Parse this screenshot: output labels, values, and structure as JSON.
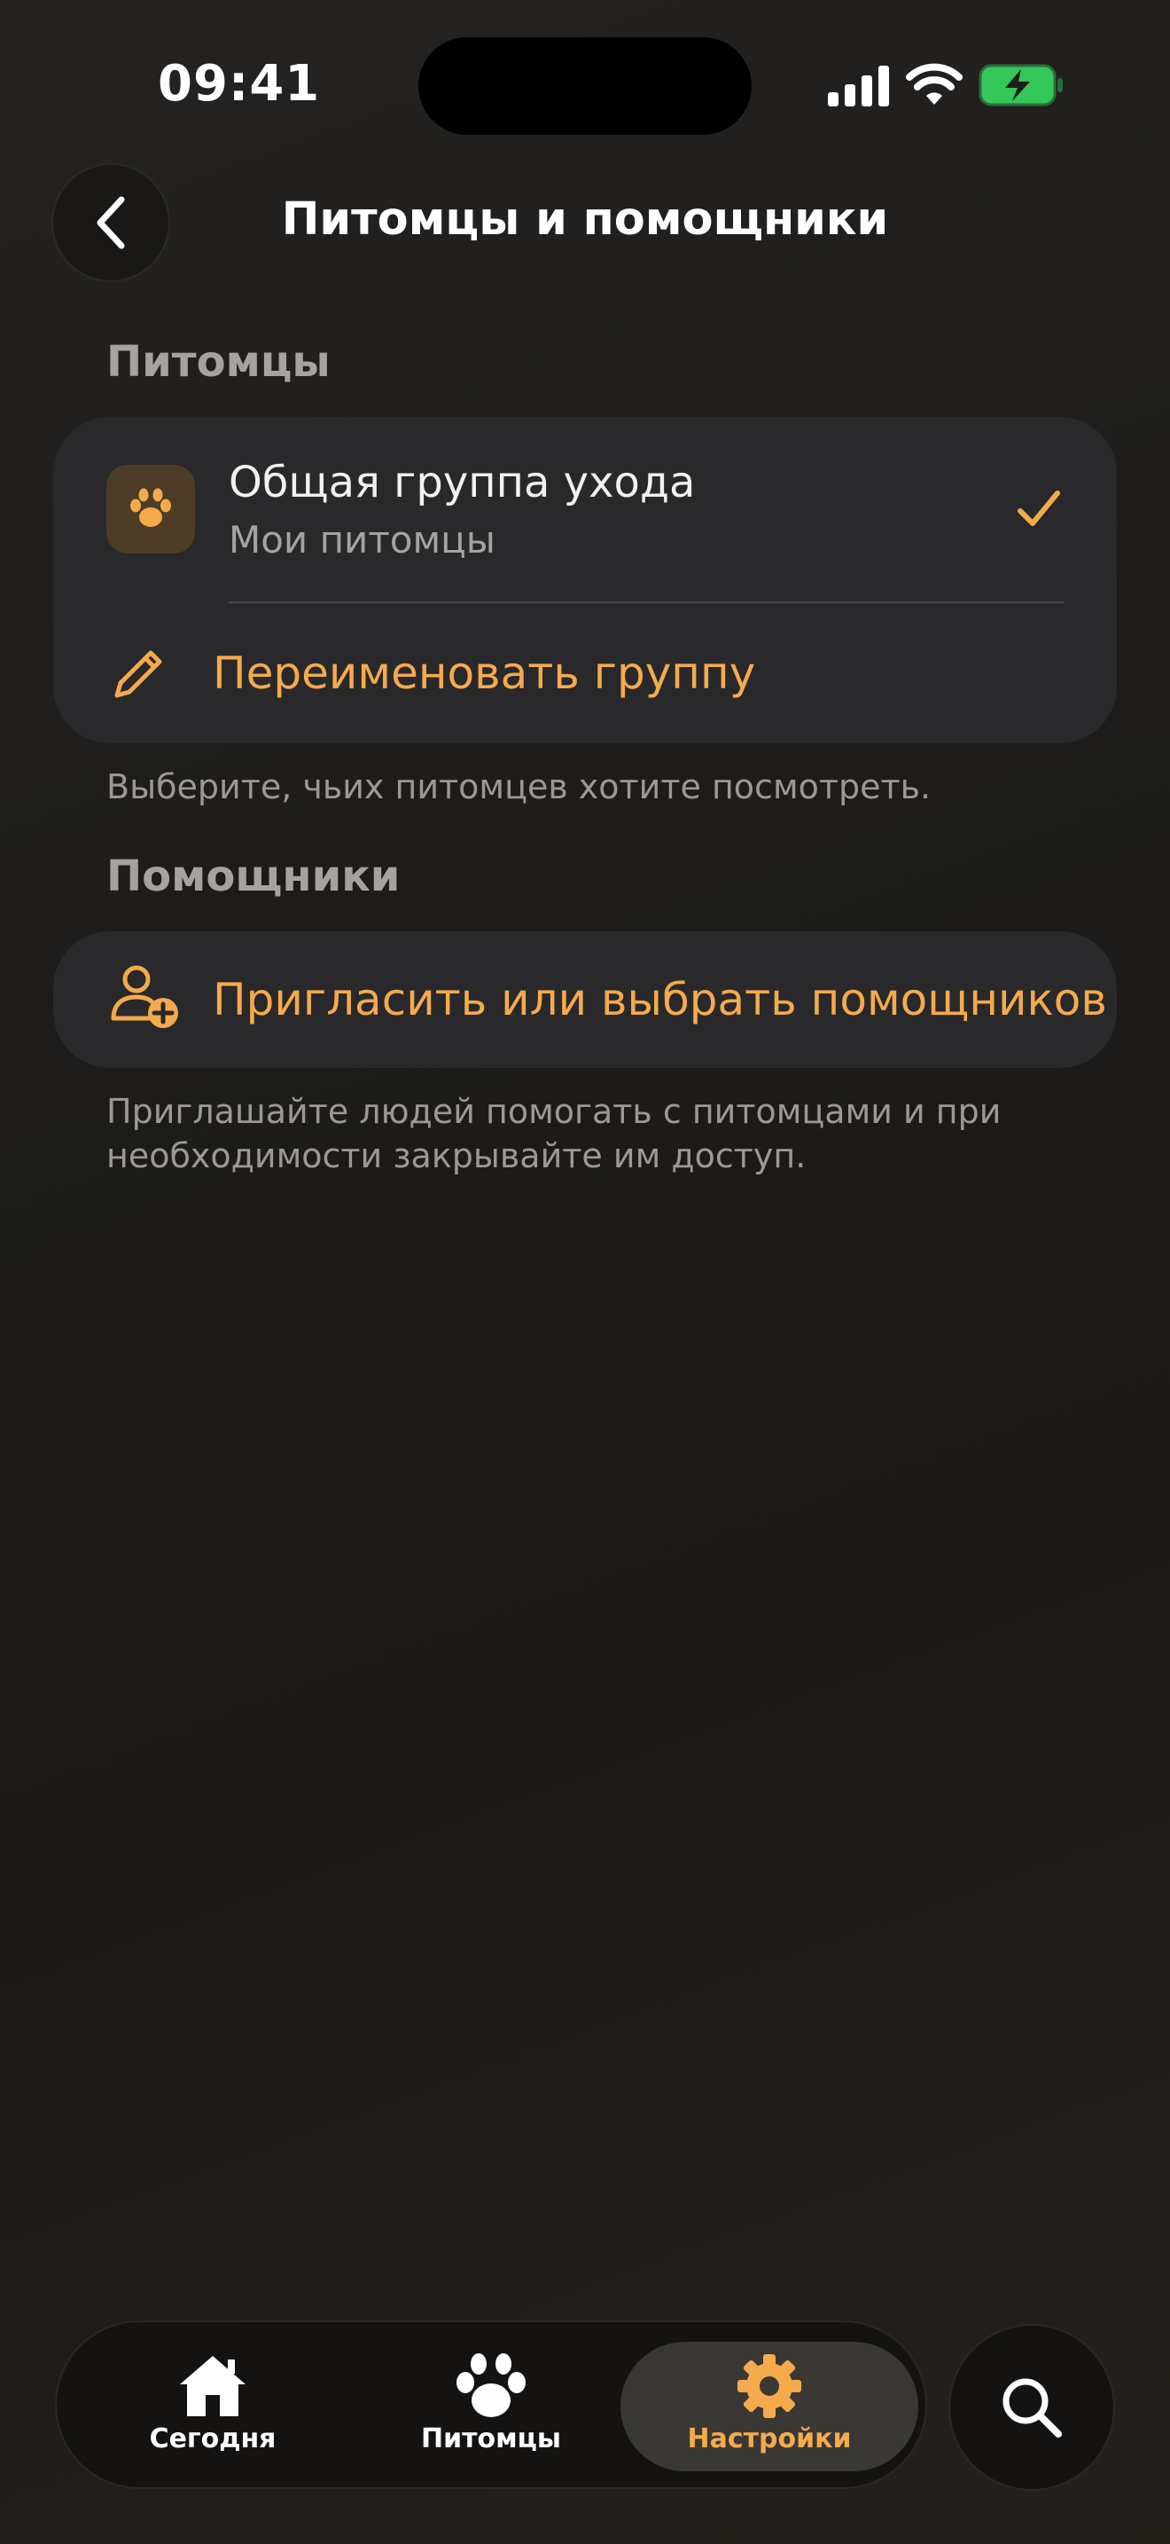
{
  "status_bar": {
    "time": "09:41"
  },
  "header": {
    "title": "Питомцы и помощники",
    "back_icon": "chevron-left-icon"
  },
  "pets_section": {
    "header": "Питомцы",
    "group": {
      "icon": "paw-icon",
      "title": "Общая группа ухода",
      "subtitle": "Мои питомцы",
      "selected": true,
      "selected_icon": "checkmark-icon"
    },
    "rename": {
      "icon": "pencil-icon",
      "label": "Переименовать группу"
    },
    "footnote": "Выберите, чьих питомцев хотите посмотреть."
  },
  "helpers_section": {
    "header": "Помощники",
    "invite": {
      "icon": "person-add-icon",
      "label": "Пригласить или выбрать помощников"
    },
    "footnote": "Приглашайте людей помогать с питомцами и при необходимости закрывайте им доступ."
  },
  "tab_bar": {
    "tabs": [
      {
        "label": "Сегодня",
        "icon": "house-icon",
        "active": false
      },
      {
        "label": "Питомцы",
        "icon": "paw-icon",
        "active": false
      },
      {
        "label": "Настройки",
        "icon": "gear-icon",
        "active": true
      }
    ],
    "search_icon": "search-icon"
  },
  "colors": {
    "accent": "#F5AA4C",
    "card": "#29282B",
    "background": "#1D1C1A",
    "battery_fill": "#34C759"
  }
}
